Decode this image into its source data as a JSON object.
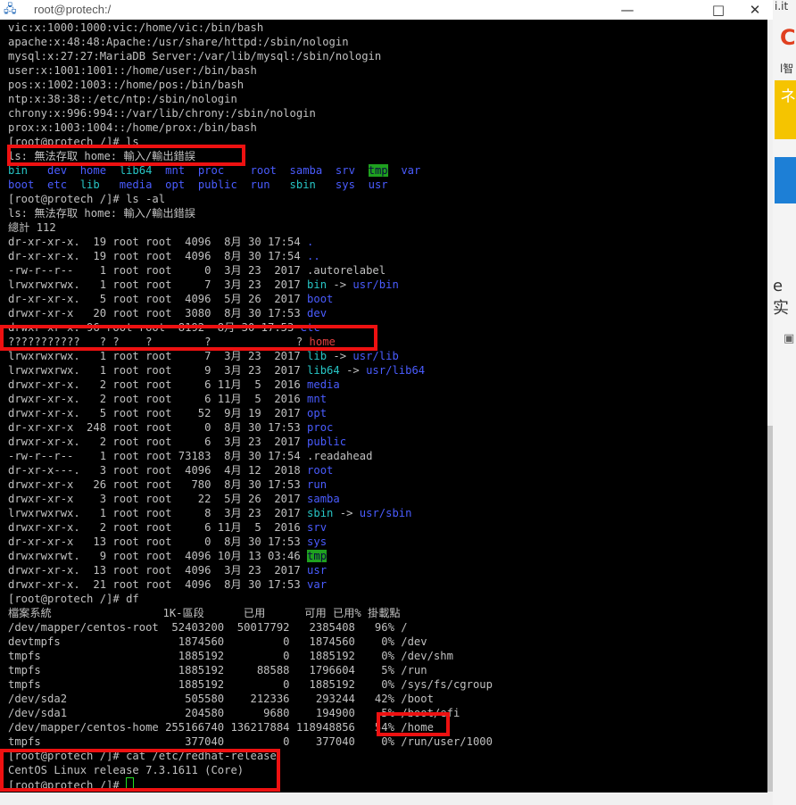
{
  "window": {
    "title": "root@protech:/",
    "app_icon": "putty-icon",
    "minimize_label": "—",
    "maximize_label": "□",
    "close_label": "✕"
  },
  "colors": {
    "terminal_bg": "#000000",
    "text": "#c0c0c0",
    "dir_blue": "#4a5cff",
    "link_cyan": "#27c5c5",
    "error_red": "#e04040",
    "tmp_highlight": "#1fa01f",
    "annotation_red": "#ee1111"
  },
  "terminal": {
    "lines": [
      [
        {
          "t": "vic:x:1000:1000:vic:/home/vic:/bin/bash"
        }
      ],
      [
        {
          "t": "apache:x:48:48:Apache:/usr/share/httpd:/sbin/nologin"
        }
      ],
      [
        {
          "t": "mysql:x:27:27:MariaDB Server:/var/lib/mysql:/sbin/nologin"
        }
      ],
      [
        {
          "t": "user:x:1001:1001::/home/user:/bin/bash"
        }
      ],
      [
        {
          "t": "pos:x:1002:1003::/home/pos:/bin/bash"
        }
      ],
      [
        {
          "t": "ntp:x:38:38::/etc/ntp:/sbin/nologin"
        }
      ],
      [
        {
          "t": "chrony:x:996:994::/var/lib/chrony:/sbin/nologin"
        }
      ],
      [
        {
          "t": "prox:x:1003:1004::/home/prox:/bin/bash"
        }
      ],
      [
        {
          "t": "[root@protech /]# ls"
        }
      ],
      [
        {
          "t": "ls: 無法存取 home: 輸入/輸出錯誤"
        }
      ],
      [
        {
          "t": "bin   ",
          "c": "cyan"
        },
        {
          "t": "dev  ",
          "c": "blue"
        },
        {
          "t": "home  ",
          "c": "blue"
        },
        {
          "t": "lib64  ",
          "c": "cyan"
        },
        {
          "t": "mnt  ",
          "c": "blue"
        },
        {
          "t": "proc    ",
          "c": "blue"
        },
        {
          "t": "root  ",
          "c": "blue"
        },
        {
          "t": "samba  ",
          "c": "blue"
        },
        {
          "t": "srv  ",
          "c": "blue"
        },
        {
          "t": "tmp",
          "c": "tmp"
        },
        {
          "t": "  "
        },
        {
          "t": "var",
          "c": "blue"
        }
      ],
      [
        {
          "t": "boot  ",
          "c": "blue"
        },
        {
          "t": "etc  ",
          "c": "blue"
        },
        {
          "t": "lib   ",
          "c": "cyan"
        },
        {
          "t": "media  ",
          "c": "blue"
        },
        {
          "t": "opt  ",
          "c": "blue"
        },
        {
          "t": "public  ",
          "c": "blue"
        },
        {
          "t": "run   ",
          "c": "blue"
        },
        {
          "t": "sbin   ",
          "c": "cyan"
        },
        {
          "t": "sys  ",
          "c": "blue"
        },
        {
          "t": "usr",
          "c": "blue"
        }
      ],
      [
        {
          "t": "[root@protech /]# ls -al"
        }
      ],
      [
        {
          "t": "ls: 無法存取 home: 輸入/輸出錯誤"
        }
      ],
      [
        {
          "t": "總計 112"
        }
      ],
      [
        {
          "t": "dr-xr-xr-x.  19 root root  4096  8月 30 17:54 "
        },
        {
          "t": ".",
          "c": "blue"
        }
      ],
      [
        {
          "t": "dr-xr-xr-x.  19 root root  4096  8月 30 17:54 "
        },
        {
          "t": "..",
          "c": "blue"
        }
      ],
      [
        {
          "t": "-rw-r--r--    1 root root     0  3月 23  2017 .autorelabel"
        }
      ],
      [
        {
          "t": "lrwxrwxrwx.   1 root root     7  3月 23  2017 "
        },
        {
          "t": "bin",
          "c": "cyan"
        },
        {
          "t": " -> "
        },
        {
          "t": "usr/bin",
          "c": "blue"
        }
      ],
      [
        {
          "t": "dr-xr-xr-x.   5 root root  4096  5月 26  2017 "
        },
        {
          "t": "boot",
          "c": "blue"
        }
      ],
      [
        {
          "t": "drwxr-xr-x   20 root root  3080  8月 30 17:53 "
        },
        {
          "t": "dev",
          "c": "blue"
        }
      ],
      [
        {
          "t": "drwxr-xr-x. 96 root root  8192  8月 30 17:53 "
        },
        {
          "t": "etc",
          "c": "blue"
        }
      ],
      [
        {
          "t": "???????????   ? ?    ?        ?             ? "
        },
        {
          "t": "home",
          "c": "red"
        }
      ],
      [
        {
          "t": "lrwxrwxrwx.   1 root root     7  3月 23  2017 "
        },
        {
          "t": "lib",
          "c": "cyan"
        },
        {
          "t": " -> "
        },
        {
          "t": "usr/lib",
          "c": "blue"
        }
      ],
      [
        {
          "t": "lrwxrwxrwx.   1 root root     9  3月 23  2017 "
        },
        {
          "t": "lib64",
          "c": "cyan"
        },
        {
          "t": " -> "
        },
        {
          "t": "usr/lib64",
          "c": "blue"
        }
      ],
      [
        {
          "t": "drwxr-xr-x.   2 root root     6 11月  5  2016 "
        },
        {
          "t": "media",
          "c": "blue"
        }
      ],
      [
        {
          "t": "drwxr-xr-x.   2 root root     6 11月  5  2016 "
        },
        {
          "t": "mnt",
          "c": "blue"
        }
      ],
      [
        {
          "t": "drwxr-xr-x.   5 root root    52  9月 19  2017 "
        },
        {
          "t": "opt",
          "c": "blue"
        }
      ],
      [
        {
          "t": "dr-xr-xr-x  248 root root     0  8月 30 17:53 "
        },
        {
          "t": "proc",
          "c": "blue"
        }
      ],
      [
        {
          "t": "drwxr-xr-x.   2 root root     6  3月 23  2017 "
        },
        {
          "t": "public",
          "c": "blue"
        }
      ],
      [
        {
          "t": "-rw-r--r--    1 root root 73183  8月 30 17:54 .readahead"
        }
      ],
      [
        {
          "t": "dr-xr-x---.   3 root root  4096  4月 12  2018 "
        },
        {
          "t": "root",
          "c": "blue"
        }
      ],
      [
        {
          "t": "drwxr-xr-x   26 root root   780  8月 30 17:53 "
        },
        {
          "t": "run",
          "c": "blue"
        }
      ],
      [
        {
          "t": "drwxr-xr-x    3 root root    22  5月 26  2017 "
        },
        {
          "t": "samba",
          "c": "blue"
        }
      ],
      [
        {
          "t": "lrwxrwxrwx.   1 root root     8  3月 23  2017 "
        },
        {
          "t": "sbin",
          "c": "cyan"
        },
        {
          "t": " -> "
        },
        {
          "t": "usr/sbin",
          "c": "blue"
        }
      ],
      [
        {
          "t": "drwxr-xr-x.   2 root root     6 11月  5  2016 "
        },
        {
          "t": "srv",
          "c": "blue"
        }
      ],
      [
        {
          "t": "dr-xr-xr-x   13 root root     0  8月 30 17:53 "
        },
        {
          "t": "sys",
          "c": "blue"
        }
      ],
      [
        {
          "t": "drwxrwxrwt.   9 root root  4096 10月 13 03:46 "
        },
        {
          "t": "tmp",
          "c": "tmp"
        }
      ],
      [
        {
          "t": "drwxr-xr-x.  13 root root  4096  3月 23  2017 "
        },
        {
          "t": "usr",
          "c": "blue"
        }
      ],
      [
        {
          "t": "drwxr-xr-x.  21 root root  4096  8月 30 17:53 "
        },
        {
          "t": "var",
          "c": "blue"
        }
      ],
      [
        {
          "t": "[root@protech /]# df"
        }
      ],
      [
        {
          "t": "檔案系統                 1K-區段      已用      可用 已用% 掛載點"
        }
      ],
      [
        {
          "t": "/dev/mapper/centos-root  52403200  50017792   2385408   96% /"
        }
      ],
      [
        {
          "t": "devtmpfs                  1874560         0   1874560    0% /dev"
        }
      ],
      [
        {
          "t": "tmpfs                     1885192         0   1885192    0% /dev/shm"
        }
      ],
      [
        {
          "t": "tmpfs                     1885192     88588   1796604    5% /run"
        }
      ],
      [
        {
          "t": "tmpfs                     1885192         0   1885192    0% /sys/fs/cgroup"
        }
      ],
      [
        {
          "t": "/dev/sda2                  505580    212336    293244   42% /boot"
        }
      ],
      [
        {
          "t": "/dev/sda1                  204580      9680    194900    5% /boot/efi"
        }
      ],
      [
        {
          "t": "/dev/mapper/centos-home 255166740 136217884 118948856   54% /home"
        }
      ],
      [
        {
          "t": "tmpfs                      377040         0    377040    0% /run/user/1000"
        }
      ],
      [
        {
          "t": "[root@protech /]# cat /etc/redhat-release"
        }
      ],
      [
        {
          "t": "CentOS Linux release 7.3.1611 (Core)"
        }
      ],
      [
        {
          "t": "[root@protech /]# "
        },
        {
          "t": "",
          "c": "cursor"
        }
      ]
    ]
  },
  "background_right": {
    "top_letter": "C",
    "text_1": "i.it",
    "text_2": "l智",
    "text_3": "ネ",
    "text_4": "e 实"
  }
}
